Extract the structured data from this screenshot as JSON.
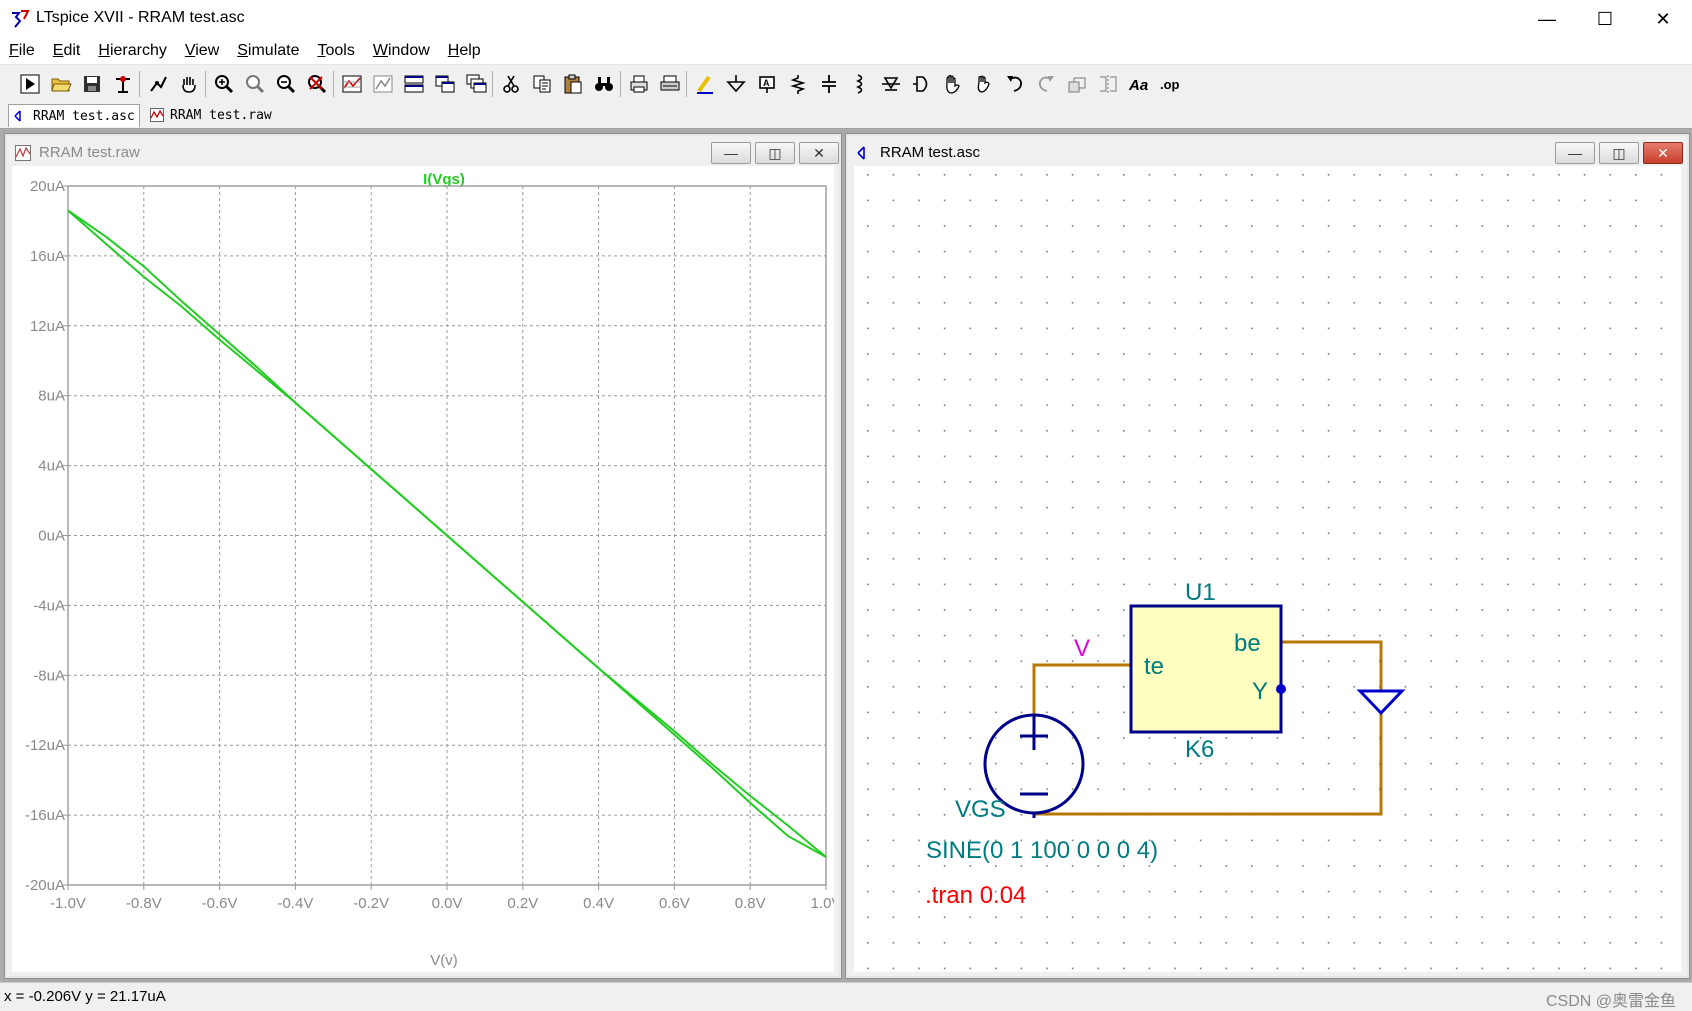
{
  "window": {
    "title": "LTspice XVII - RRAM test.asc",
    "minimize": "—",
    "maximize": "☐",
    "close": "✕"
  },
  "menu": {
    "items": [
      {
        "label": "File",
        "key": "F"
      },
      {
        "label": "Edit",
        "key": "E"
      },
      {
        "label": "Hierarchy",
        "key": "H"
      },
      {
        "label": "View",
        "key": "V"
      },
      {
        "label": "Simulate",
        "key": "S"
      },
      {
        "label": "Tools",
        "key": "T"
      },
      {
        "label": "Window",
        "key": "W"
      },
      {
        "label": "Help",
        "key": "H"
      }
    ]
  },
  "toolbar": {
    "tools": [
      "run-icon",
      "open-icon",
      "save-icon",
      "control-panel-icon",
      "run-probe-icon",
      "pan-icon",
      "zoom-in-icon",
      "zoom-rect-icon",
      "zoom-out-icon",
      "zoom-cancel-icon",
      "autorange-icon",
      "mark-unmark-icon",
      "tile-horizontal-icon",
      "tile-vertical-icon",
      "cascade-icon",
      "cut-icon",
      "copy-icon",
      "paste-icon",
      "find-icon",
      "print-icon",
      "print-setup-icon",
      "draw-wire-icon",
      "ground-icon",
      "label-net-icon",
      "resistor-icon",
      "capacitor-icon",
      "inductor-icon",
      "diode-icon",
      "component-icon",
      "move-icon",
      "drag-icon",
      "undo-icon",
      "redo-icon",
      "rotate-icon",
      "mirror-icon",
      "text-icon",
      "spice-directive-icon"
    ],
    "text_label": "Aa",
    "op_label": ".op"
  },
  "tabs": [
    {
      "label": "RRAM test.asc",
      "active": true,
      "icon": "schematic-icon"
    },
    {
      "label": "RRAM test.raw",
      "active": false,
      "icon": "waveform-icon"
    }
  ],
  "waveform_window": {
    "title": "RRAM test.raw",
    "minimize": "—",
    "restore": "◫",
    "close": "✕"
  },
  "schematic_window": {
    "title": "RRAM test.asc",
    "minimize": "—",
    "restore": "◫",
    "close": "✕"
  },
  "chart_data": {
    "type": "line",
    "title": "I(Vgs)",
    "xlabel": "V(v)",
    "ylabel": "",
    "xlim": [
      -1.0,
      1.0
    ],
    "ylim": [
      -20,
      20
    ],
    "grid": true,
    "x_ticks": [
      -1.0,
      -0.8,
      -0.6,
      -0.4,
      -0.2,
      0.0,
      0.2,
      0.4,
      0.6,
      0.8,
      1.0
    ],
    "x_tick_labels": [
      "-1.0V",
      "-0.8V",
      "-0.6V",
      "-0.4V",
      "-0.2V",
      "0.0V",
      "0.2V",
      "0.4V",
      "0.6V",
      "0.8V",
      "1.0V"
    ],
    "y_ticks": [
      20,
      16,
      12,
      8,
      4,
      0,
      -4,
      -8,
      -12,
      -16,
      -20
    ],
    "y_tick_labels": [
      "20uA",
      "16uA",
      "12uA",
      "8uA",
      "4uA",
      "0uA",
      "-4uA",
      "-8uA",
      "-12uA",
      "-16uA",
      "-20uA"
    ],
    "series": [
      {
        "name": "I(Vgs)",
        "color": "#22cc22",
        "x": [
          -1.0,
          -0.9,
          -0.8,
          -0.7,
          -0.6,
          -0.5,
          -0.4,
          -0.3,
          -0.2,
          -0.1,
          0.0,
          0.1,
          0.2,
          0.3,
          0.4,
          0.5,
          0.6,
          0.7,
          0.8,
          0.9,
          1.0
        ],
        "y": [
          18.6,
          16.7,
          14.8,
          13.1,
          11.2,
          9.4,
          7.6,
          5.7,
          3.8,
          1.9,
          0.0,
          -1.9,
          -3.8,
          -5.7,
          -7.6,
          -9.4,
          -11.2,
          -13.1,
          -14.9,
          -16.6,
          -18.4
        ]
      },
      {
        "name": "I(Vgs) return",
        "color": "#22cc22",
        "x": [
          1.0,
          0.9,
          0.8,
          0.7,
          0.6,
          0.5,
          0.4,
          0.3,
          0.2,
          0.1,
          0.0,
          -0.1,
          -0.2,
          -0.3,
          -0.4,
          -0.5,
          -0.6,
          -0.7,
          -0.8,
          -0.9,
          -1.0
        ],
        "y": [
          -18.4,
          -17.2,
          -15.3,
          -13.3,
          -11.4,
          -9.5,
          -7.6,
          -5.7,
          -3.8,
          -1.9,
          0.0,
          1.9,
          3.8,
          5.7,
          7.6,
          9.6,
          11.5,
          13.4,
          15.4,
          17.1,
          18.6
        ]
      }
    ]
  },
  "schematic": {
    "component_name": "U1",
    "component_value": "K6",
    "pin_te": "te",
    "pin_be": "be",
    "pin_y": "Y",
    "net_label": "V",
    "source_name": "VGS",
    "source_value": "SINE(0 1 100 0 0 0 4)",
    "directive": ".tran 0.04",
    "colors": {
      "wire": "#b87800",
      "component": "#00008b",
      "component_fill": "#ffffc0",
      "text": "#007b80",
      "net": "#e000e0",
      "directive": "#ff0000"
    }
  },
  "status": {
    "coords": "x = -0.206V    y = 21.17uA",
    "watermark": "CSDN @奥雷金鱼"
  }
}
